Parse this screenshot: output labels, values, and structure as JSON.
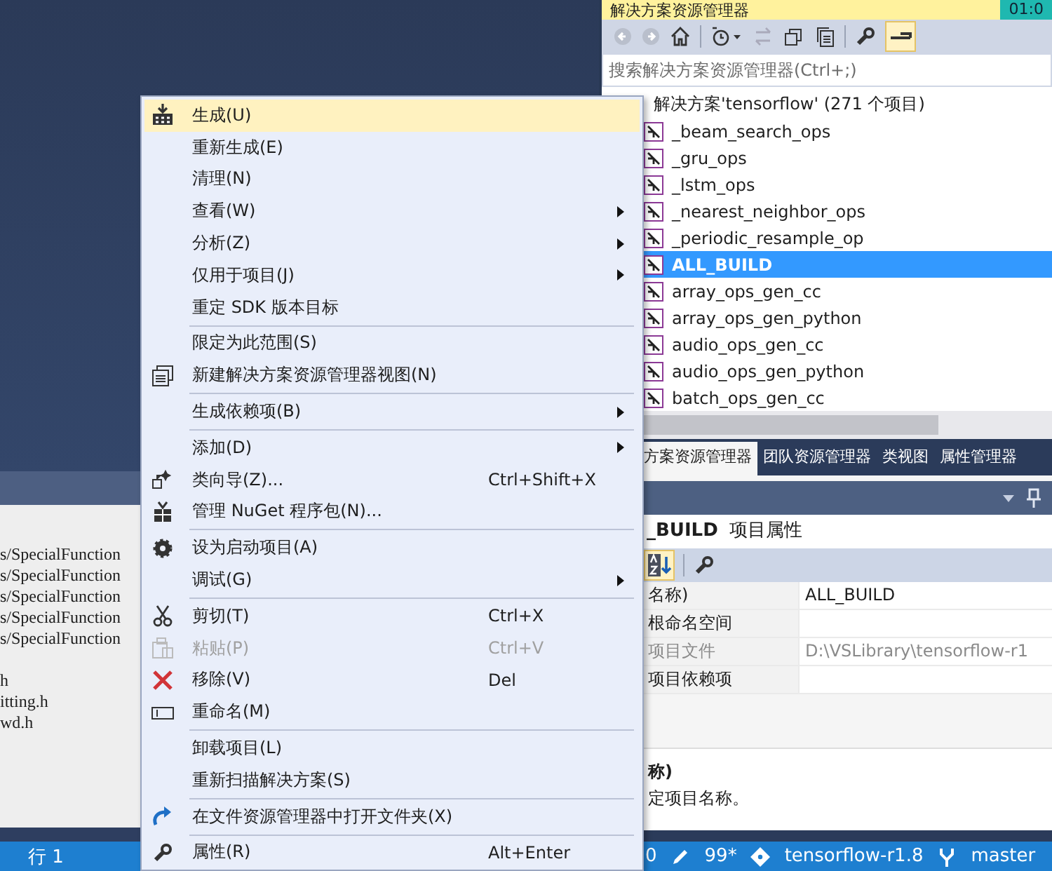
{
  "solution_explorer": {
    "title": "解决方案资源管理器",
    "clock": "01:0",
    "search": {
      "placeholder": "搜索解决方案资源管理器(Ctrl+;)"
    },
    "tree": {
      "label": "解决方案'tensorflow' (271 个项目)",
      "children": [
        {
          "label": "_beam_search_ops",
          "selected": false
        },
        {
          "label": "_gru_ops",
          "selected": false
        },
        {
          "label": "_lstm_ops",
          "selected": false
        },
        {
          "label": "_nearest_neighbor_ops",
          "selected": false
        },
        {
          "label": "_periodic_resample_op",
          "selected": false
        },
        {
          "label": "ALL_BUILD",
          "selected": true
        },
        {
          "label": "array_ops_gen_cc",
          "selected": false
        },
        {
          "label": "array_ops_gen_python",
          "selected": false
        },
        {
          "label": "audio_ops_gen_cc",
          "selected": false
        },
        {
          "label": "audio_ops_gen_python",
          "selected": false
        },
        {
          "label": "batch_ops_gen_cc",
          "selected": false
        }
      ]
    }
  },
  "panel_tabs": [
    {
      "label": "方案资源管理器",
      "selected": true
    },
    {
      "label": "团队资源管理器",
      "selected": false
    },
    {
      "label": "类视图",
      "selected": false
    },
    {
      "label": "属性管理器",
      "selected": false
    }
  ],
  "properties": {
    "name": "_BUILD",
    "suffix": "项目属性",
    "sort_alphabetical": true,
    "rows": [
      {
        "name": "名称)",
        "value": "ALL_BUILD",
        "disabled": false
      },
      {
        "name": "根命名空间",
        "disabled": false
      },
      {
        "name": "项目文件",
        "value": "D:\\VSLibrary\\tensorflow-r1",
        "disabled": true
      },
      {
        "name": "项目依赖项",
        "disabled": false
      }
    ],
    "description": {
      "title": "称)",
      "text": "定项目名称。"
    }
  },
  "output": {
    "lines": [
      "s/SpecialFunction",
      "s/SpecialFunction",
      "s/SpecialFunction",
      "s/SpecialFunction",
      "s/SpecialFunction",
      "h",
      "itting.h",
      "wd.h"
    ]
  },
  "context_menu": {
    "items": [
      {
        "kind": "item",
        "label": "生成(U)",
        "selected": true,
        "disabled": false,
        "submenu": false
      },
      {
        "kind": "item",
        "label": "重新生成(E)",
        "selected": false,
        "disabled": false,
        "submenu": false
      },
      {
        "kind": "item",
        "label": "清理(N)",
        "selected": false,
        "disabled": false,
        "submenu": false
      },
      {
        "kind": "item",
        "label": "查看(W)",
        "selected": false,
        "disabled": false,
        "submenu": true
      },
      {
        "kind": "item",
        "label": "分析(Z)",
        "selected": false,
        "disabled": false,
        "submenu": true
      },
      {
        "kind": "item",
        "label": "仅用于项目(J)",
        "selected": false,
        "disabled": false,
        "submenu": true
      },
      {
        "kind": "item",
        "label": "重定 SDK 版本目标",
        "selected": false,
        "disabled": false,
        "submenu": false
      },
      {
        "kind": "separator"
      },
      {
        "kind": "item",
        "label": "限定为此范围(S)",
        "selected": false,
        "disabled": false,
        "submenu": false
      },
      {
        "kind": "item",
        "label": "新建解决方案资源管理器视图(N)",
        "selected": false,
        "disabled": false,
        "submenu": false
      },
      {
        "kind": "separator"
      },
      {
        "kind": "item",
        "label": "生成依赖项(B)",
        "selected": false,
        "disabled": false,
        "submenu": true
      },
      {
        "kind": "separator"
      },
      {
        "kind": "item",
        "label": "添加(D)",
        "selected": false,
        "disabled": false,
        "submenu": true
      },
      {
        "kind": "item",
        "label": "类向导(Z)...",
        "shortcut": "Ctrl+Shift+X",
        "selected": false,
        "disabled": false,
        "submenu": false
      },
      {
        "kind": "item",
        "label": "管理 NuGet 程序包(N)...",
        "selected": false,
        "disabled": false,
        "submenu": false
      },
      {
        "kind": "separator"
      },
      {
        "kind": "item",
        "label": "设为启动项目(A)",
        "selected": false,
        "disabled": false,
        "submenu": false
      },
      {
        "kind": "item",
        "label": "调试(G)",
        "selected": false,
        "disabled": false,
        "submenu": true
      },
      {
        "kind": "separator"
      },
      {
        "kind": "item",
        "label": "剪切(T)",
        "shortcut": "Ctrl+X",
        "selected": false,
        "disabled": false,
        "submenu": false
      },
      {
        "kind": "item",
        "label": "粘贴(P)",
        "shortcut": "Ctrl+V",
        "selected": false,
        "disabled": true,
        "submenu": false
      },
      {
        "kind": "item",
        "label": "移除(V)",
        "shortcut": "Del",
        "selected": false,
        "disabled": false,
        "submenu": false
      },
      {
        "kind": "item",
        "label": "重命名(M)",
        "selected": false,
        "disabled": false,
        "submenu": false
      },
      {
        "kind": "separator"
      },
      {
        "kind": "item",
        "label": "卸载项目(L)",
        "selected": false,
        "disabled": false,
        "submenu": false
      },
      {
        "kind": "item",
        "label": "重新扫描解决方案(S)",
        "selected": false,
        "disabled": false,
        "submenu": false
      },
      {
        "kind": "separator"
      },
      {
        "kind": "item",
        "label": "在文件资源管理器中打开文件夹(X)",
        "selected": false,
        "disabled": false,
        "submenu": false
      },
      {
        "kind": "separator"
      },
      {
        "kind": "item",
        "label": "属性(R)",
        "shortcut": "Alt+Enter",
        "selected": false,
        "disabled": false,
        "submenu": false
      }
    ]
  },
  "status_bar": {
    "position": "行 1",
    "errors": "0",
    "changes": "99*",
    "repository": "tensorflow-r1.8",
    "branch": "master"
  }
}
